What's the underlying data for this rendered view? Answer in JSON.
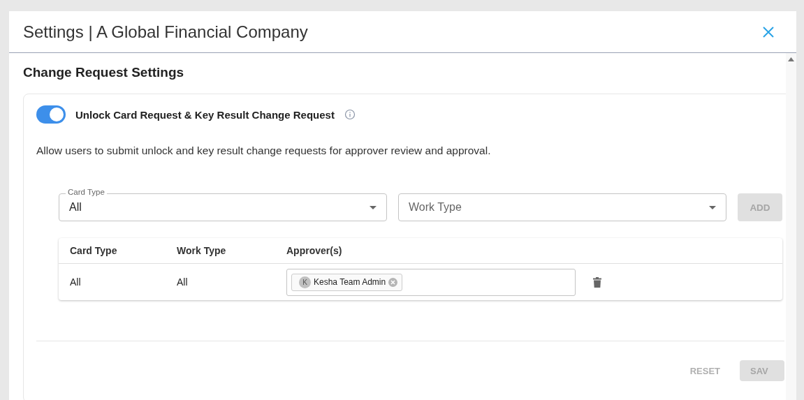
{
  "window": {
    "title": "Settings | A Global Financial Company"
  },
  "section": {
    "title": "Change Request Settings"
  },
  "setting": {
    "label": "Unlock Card Request & Key Result Change Request",
    "on": true,
    "description": "Allow users to submit unlock and key result change requests for approver review and approval."
  },
  "filters": [
    {
      "label": "Card Type",
      "value": "All"
    },
    {
      "placeholder": "Work Type"
    }
  ],
  "add_button": {
    "label": "ADD",
    "disabled": true
  },
  "table": {
    "columns": [
      "Card Type",
      "Work Type",
      "Approver(s)"
    ],
    "rows": [
      {
        "card_type": "All",
        "work_type": "All",
        "approvers": [
          {
            "initial": "K",
            "name": "Kesha Team Admin"
          }
        ]
      }
    ]
  },
  "footer": [
    {
      "label": "RESET",
      "kind": "text",
      "disabled": true
    },
    {
      "label": "SAV",
      "kind": "filled",
      "disabled": true
    }
  ]
}
